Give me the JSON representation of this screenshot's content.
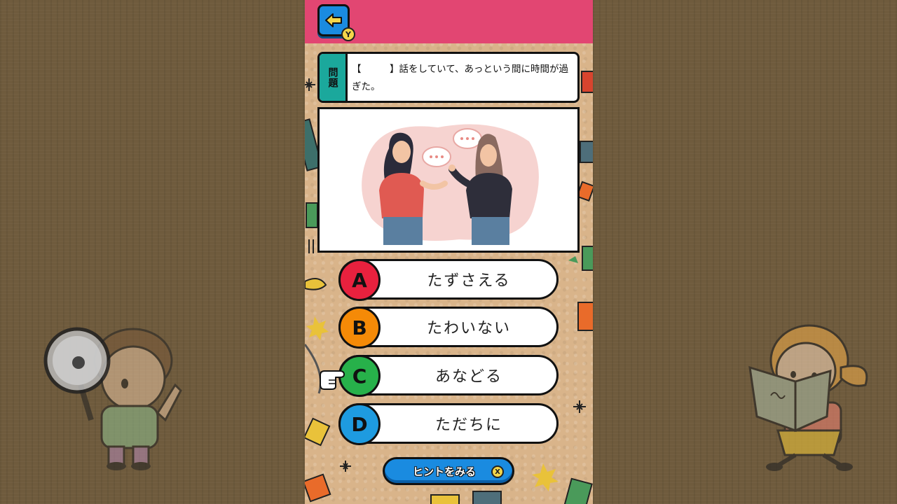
{
  "header": {
    "back_icon": "arrow-left-icon",
    "back_button_badge": "Y",
    "bar_color": "#e24672"
  },
  "question": {
    "tag": "問題",
    "text": "【　　　】話をしていて、あっという間に時間が過ぎた。",
    "tag_color": "#1ba89c"
  },
  "illustration": {
    "icon": "two-women-talking-illustration"
  },
  "answers": [
    {
      "letter": "A",
      "text": "たずさえる",
      "color": "#e8213e"
    },
    {
      "letter": "B",
      "text": "たわいない",
      "color": "#f58a07"
    },
    {
      "letter": "C",
      "text": "あなどる",
      "color": "#27b14a"
    },
    {
      "letter": "D",
      "text": "ただちに",
      "color": "#1e9be0"
    }
  ],
  "hint": {
    "label": "ヒントをみる",
    "badge": "X"
  },
  "selection": {
    "pointer_icon": "pointing-hand-icon",
    "pointed_answer": "C"
  },
  "side_characters": {
    "left": "detective-boy-magnifier-icon",
    "right": "girl-reading-book-icon"
  }
}
